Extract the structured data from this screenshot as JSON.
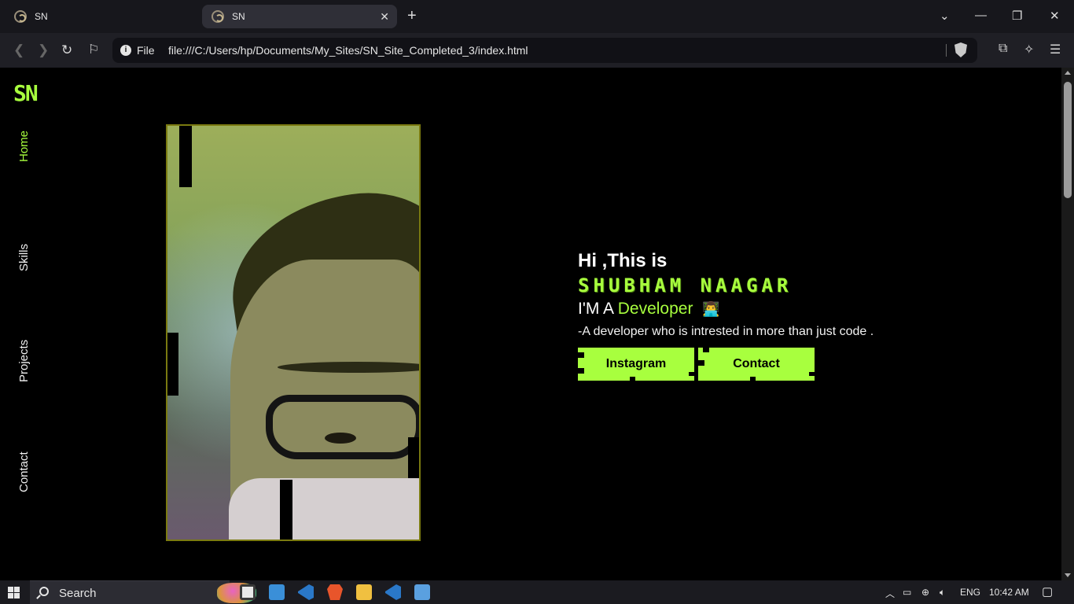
{
  "browser": {
    "tabs": [
      {
        "title": "SN",
        "active": false
      },
      {
        "title": "SN",
        "active": true
      }
    ],
    "new_tab": "+",
    "address": {
      "scheme_label": "File",
      "url": "file:///C:/Users/hp/Documents/My_Sites/SN_Site_Completed_3/index.html"
    }
  },
  "page": {
    "logo": "SN",
    "nav": [
      "Home",
      "Skills",
      "Projects",
      "Contact"
    ],
    "active_nav": "Home",
    "hero": {
      "greeting": "Hi ,This is",
      "name": "SHUBHAM NAAGAR",
      "role_prefix": "I'M A",
      "role": "Developer",
      "role_emoji": "👨‍💻",
      "tagline": "-A developer who is intrested in more than just code ."
    },
    "buttons": {
      "instagram": "Instagram",
      "contact": "Contact"
    },
    "accent_color": "#a8ff3e"
  },
  "taskbar": {
    "search_label": "Search",
    "language": "ENG",
    "time": "10:42 AM"
  }
}
